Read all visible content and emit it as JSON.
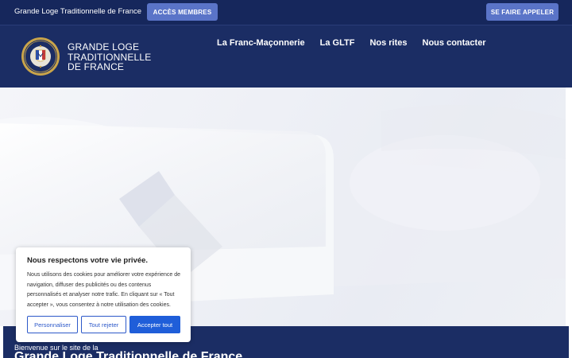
{
  "topbar": {
    "site_name": "Grande Loge Traditionnelle de France",
    "members_button": "ACCÈS MEMBRES",
    "call_button": "SE FAIRE APPELER"
  },
  "header": {
    "brand_line1": "GRANDE LOGE",
    "brand_line2": "TRADITIONNELLE",
    "brand_line3": "DE FRANCE",
    "nav": [
      {
        "label": "La Franc-Maçonnerie"
      },
      {
        "label": "La GLTF"
      },
      {
        "label": "Nos rites"
      },
      {
        "label": "Nous contacter"
      }
    ]
  },
  "band": {
    "welcome": "Bienvenue sur le site de la",
    "title": "Grande Loge Traditionnelle de France"
  },
  "cookie": {
    "title": "Nous respectons votre vie privée.",
    "text": "Nous utilisons des cookies pour améliorer votre expérience de navigation, diffuser des publicités ou des contenus personnalisés et analyser notre trafic. En cliquant sur « Tout accepter », vous consentez à notre utilisation des cookies.",
    "btn_customize": "Personnaliser",
    "btn_reject": "Tout rejeter",
    "btn_accept": "Accepter tout"
  },
  "colors": {
    "navy": "#1b2d64",
    "topbar": "#16275c",
    "button_blue": "#5a74c8",
    "accept_blue": "#1f5ed9"
  }
}
